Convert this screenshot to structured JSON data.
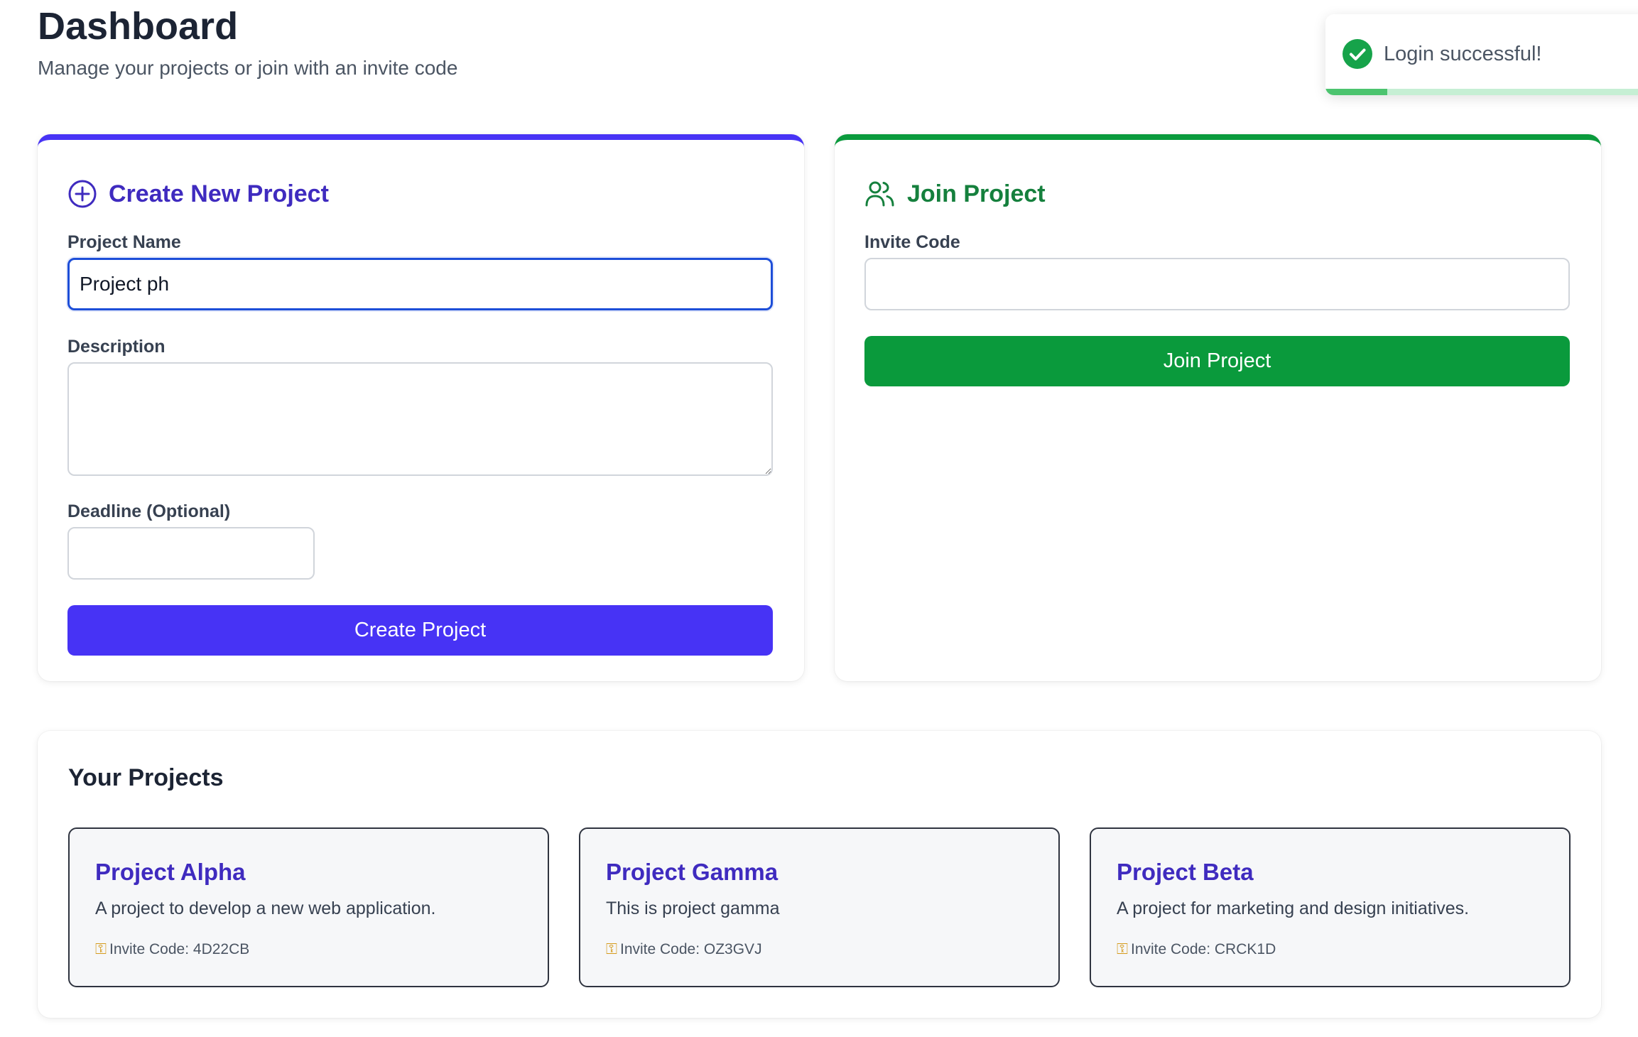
{
  "header": {
    "title": "Dashboard",
    "subtitle": "Manage your projects or join with an invite code"
  },
  "toast": {
    "message": "Login successful!",
    "icon": "check-circle-icon",
    "progress": 0.19
  },
  "create_project": {
    "title": "Create New Project",
    "icon": "plus-circle-icon",
    "name_label": "Project Name",
    "name_value": "Project ph",
    "description_label": "Description",
    "description_value": "",
    "deadline_label": "Deadline (Optional)",
    "deadline_value": "",
    "submit_label": "Create Project"
  },
  "join_project": {
    "title": "Join Project",
    "icon": "users-icon",
    "code_label": "Invite Code",
    "code_value": "",
    "submit_label": "Join Project"
  },
  "projects": {
    "title": "Your Projects",
    "items": [
      {
        "name": "Project Alpha",
        "description": "A project to develop a new web application.",
        "invite_label": "Invite Code: 4D22CB",
        "icon": "key-icon"
      },
      {
        "name": "Project Gamma",
        "description": "This is project gamma",
        "invite_label": "Invite Code: OZ3GVJ",
        "icon": "key-icon"
      },
      {
        "name": "Project Beta",
        "description": "A project for marketing and design initiatives.",
        "invite_label": "Invite Code: CRCK1D",
        "icon": "key-icon"
      }
    ]
  },
  "colors": {
    "primary": "#4733f5",
    "primary_text": "#3f2bbf",
    "success": "#0a9a3c",
    "success_text": "#15803d",
    "focus_border": "#1d4ed8"
  }
}
